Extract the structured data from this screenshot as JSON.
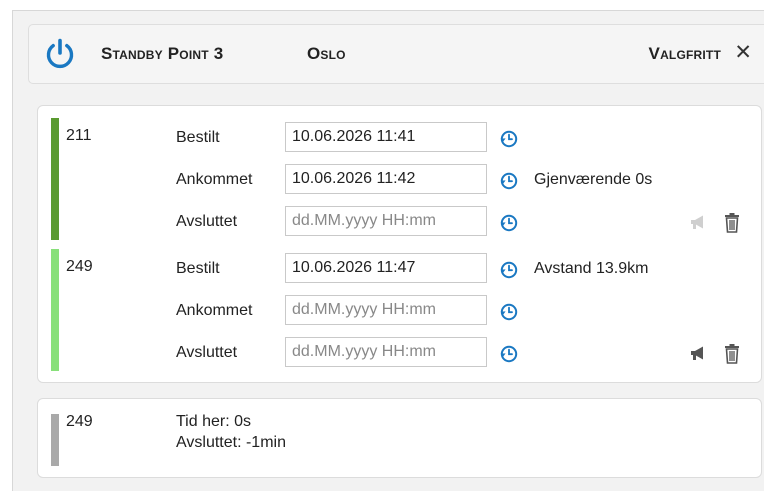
{
  "colors": {
    "accent_blue": "#1a78c2",
    "status_dark_green": "#5a9a30",
    "status_light_green": "#88e07a",
    "status_gray": "#a9a9a9"
  },
  "header": {
    "icon": "power-icon",
    "title": "Standby Point 3",
    "city": "Oslo",
    "optional_label": "Valgfritt",
    "close_icon": "close-icon",
    "close_glyph": "✕"
  },
  "vehicles": [
    {
      "id": "211",
      "status_color": "#5a9a30",
      "rows": [
        {
          "label": "Bestilt",
          "value": "10.06.2026 11:41",
          "placeholder": "dd.MM.yyyy HH:mm",
          "note": ""
        },
        {
          "label": "Ankommet",
          "value": "10.06.2026 11:42",
          "placeholder": "dd.MM.yyyy HH:mm",
          "note": "Gjenværende 0s"
        },
        {
          "label": "Avsluttet",
          "value": "",
          "placeholder": "dd.MM.yyyy HH:mm",
          "note": ""
        }
      ],
      "megaphone_state": "disabled"
    },
    {
      "id": "249",
      "status_color": "#88e07a",
      "rows": [
        {
          "label": "Bestilt",
          "value": "10.06.2026 11:47",
          "placeholder": "dd.MM.yyyy HH:mm",
          "note": "Avstand 13.9km"
        },
        {
          "label": "Ankommet",
          "value": "",
          "placeholder": "dd.MM.yyyy HH:mm",
          "note": ""
        },
        {
          "label": "Avsluttet",
          "value": "",
          "placeholder": "dd.MM.yyyy HH:mm",
          "note": ""
        }
      ],
      "megaphone_state": "enabled"
    }
  ],
  "summary": {
    "id": "249",
    "time_here": "Tid her:   0s",
    "finished": "Avsluttet: -1min"
  }
}
